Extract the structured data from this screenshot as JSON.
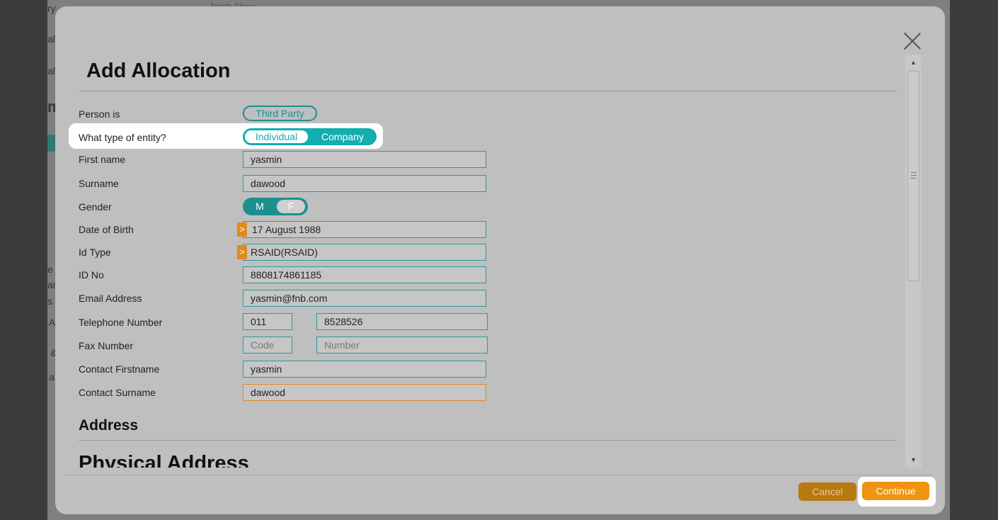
{
  "background": {
    "fragments": [
      "ry",
      "al",
      "al",
      "m",
      "e",
      "ar",
      "s",
      "A",
      "&",
      "a"
    ],
    "top_fragment": "North Africa"
  },
  "modal": {
    "title": "Add Allocation",
    "fields": {
      "person_is": {
        "label": "Person is",
        "value": "Third Party"
      },
      "entity_type": {
        "label": "What type of entity?",
        "options": [
          "Individual",
          "Company"
        ],
        "selected": "Company"
      },
      "first_name": {
        "label": "First name",
        "value": "yasmin"
      },
      "surname": {
        "label": "Surname",
        "value": "dawood"
      },
      "gender": {
        "label": "Gender",
        "options": [
          "M",
          "F"
        ],
        "selected": "M"
      },
      "dob": {
        "label": "Date of Birth",
        "value": "17 August   1988"
      },
      "id_type": {
        "label": "Id Type",
        "value": "RSAID(RSAID)"
      },
      "id_no": {
        "label": "ID No",
        "value": "8808174861185"
      },
      "email": {
        "label": "Email Address",
        "value": "yasmin@fnb.com"
      },
      "telephone": {
        "label": "Telephone Number",
        "code": "011",
        "number": "8528526"
      },
      "fax": {
        "label": "Fax Number",
        "code_placeholder": "Code",
        "number_placeholder": "Number"
      },
      "contact_firstname": {
        "label": "Contact Firstname",
        "value": "yasmin"
      },
      "contact_surname": {
        "label": "Contact Surname",
        "value": "dawood"
      }
    },
    "sections": {
      "address": "Address",
      "physical_address": "Physical Address"
    },
    "buttons": {
      "cancel": "Cancel",
      "continue": "Continue"
    }
  },
  "colors": {
    "teal": "#1e8f8f",
    "teal_bright": "#12aeb0",
    "orange": "#ef9311",
    "modal_bg": "#bfbfbf"
  }
}
